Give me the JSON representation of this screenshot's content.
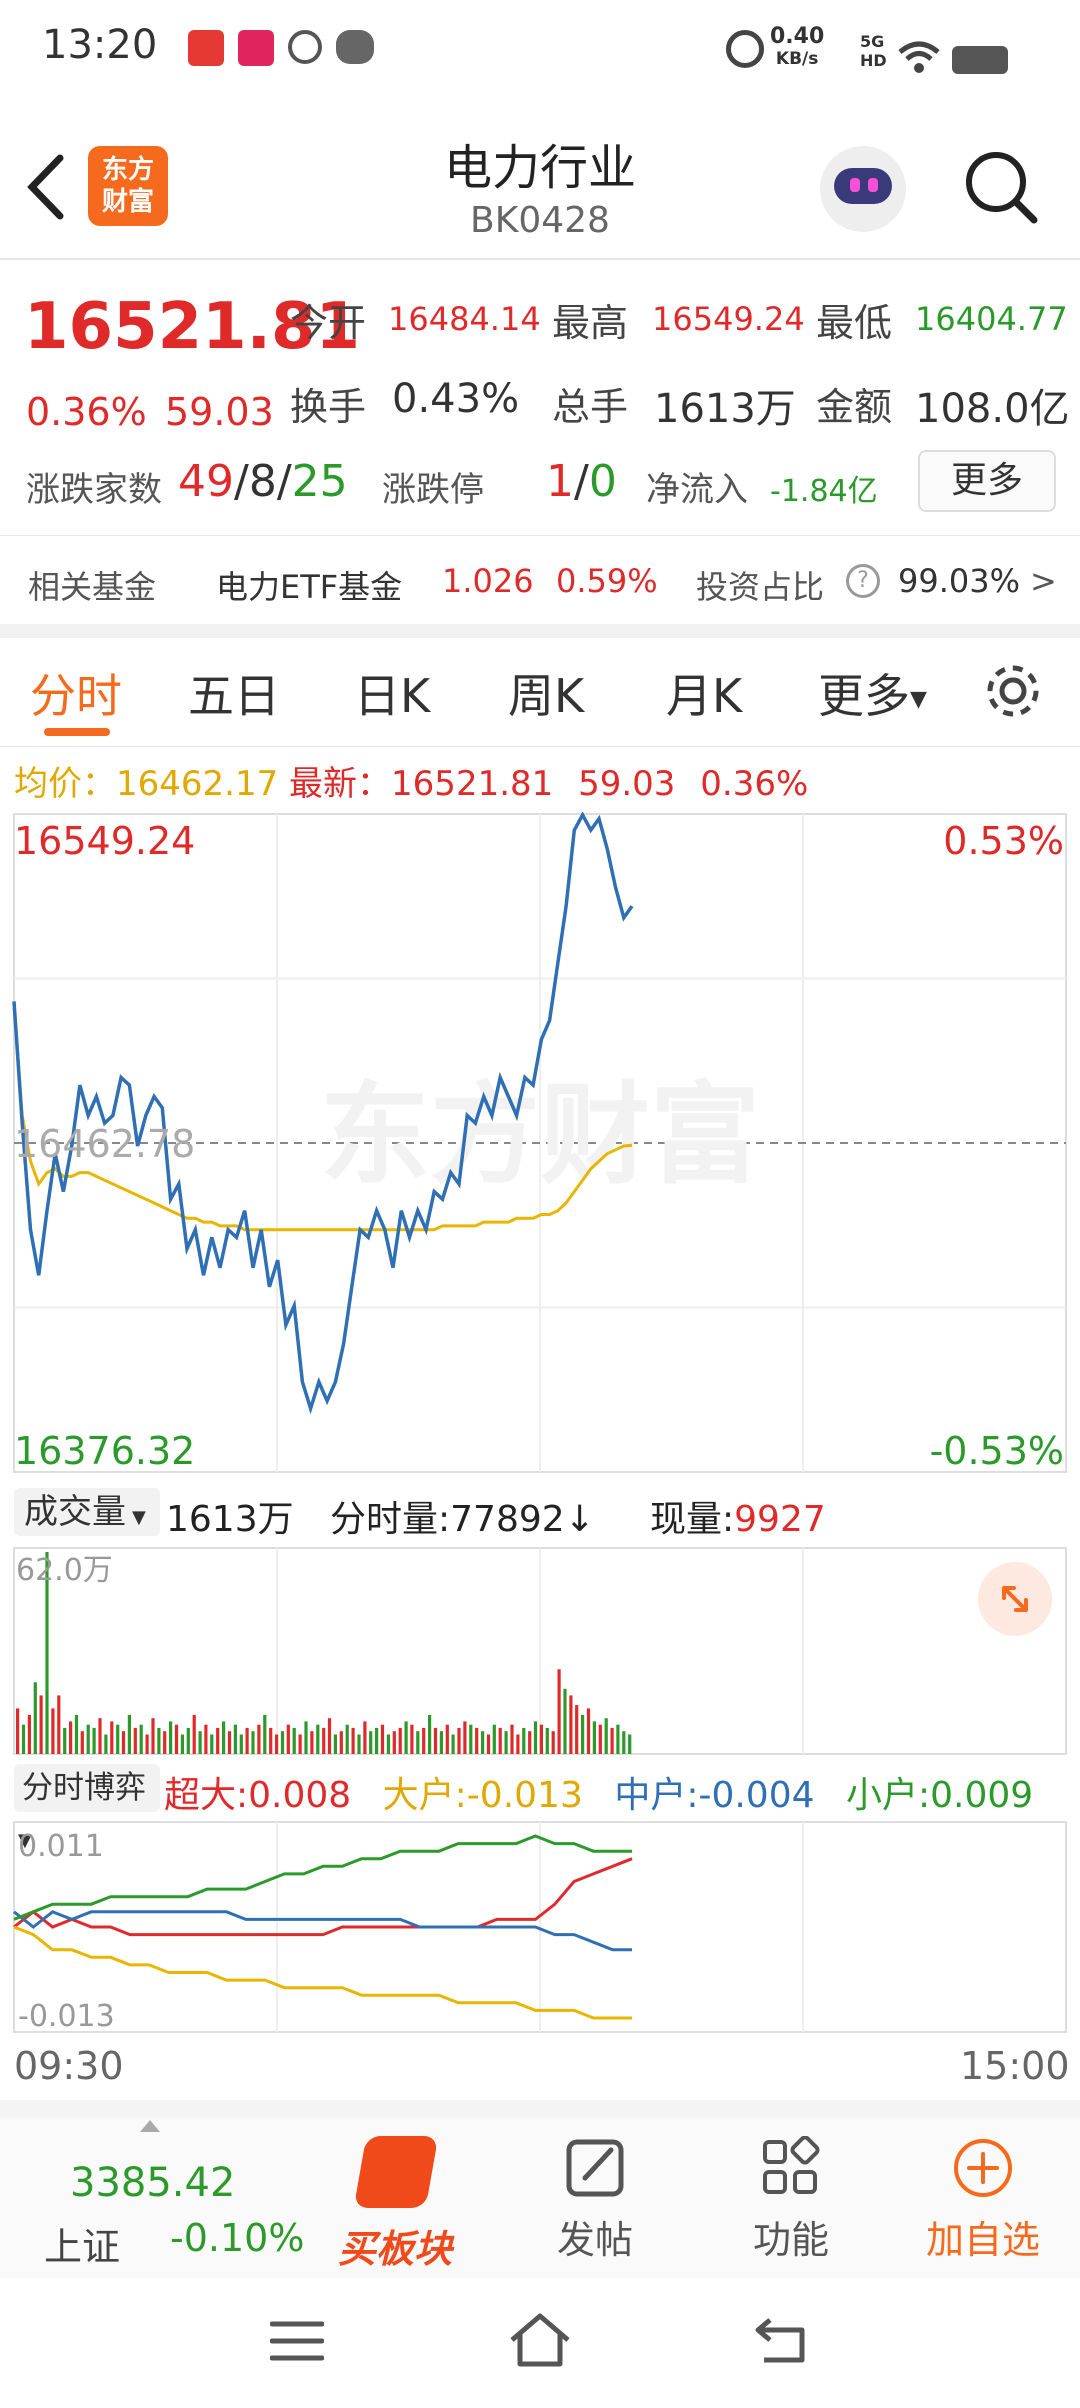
{
  "status_bar": {
    "time": "13:20",
    "net_speed": "0.40",
    "net_unit": "KB/s",
    "signal": "5G HD"
  },
  "header": {
    "title": "电力行业",
    "code": "BK0428",
    "logo_text_1": "东方",
    "logo_text_2": "财富"
  },
  "quote": {
    "price": "16521.81",
    "change_pct": "0.36%",
    "change": "59.03",
    "open_label": "今开",
    "open": "16484.14",
    "high_label": "最高",
    "high": "16549.24",
    "low_label": "最低",
    "low": "16404.77",
    "turnover_label": "换手",
    "turnover": "0.43%",
    "volume_label": "总手",
    "volume": "1613万",
    "amount_label": "金额",
    "amount": "108.0亿",
    "breadth_label": "涨跌家数",
    "up": "49",
    "flat": "8",
    "down": "25",
    "limit_label": "涨跌停",
    "limit_up": "1",
    "limit_down": "0",
    "inflow_label": "净流入",
    "inflow": "-1.84亿",
    "more_button": "更多"
  },
  "fund": {
    "label": "相关基金",
    "name": "电力ETF基金",
    "price": "1.026",
    "pct": "0.59%",
    "ratio_label": "投资占比",
    "ratio": "99.03%",
    "arrow": ">"
  },
  "tabs": [
    "分时",
    "五日",
    "日K",
    "周K",
    "月K",
    "更多"
  ],
  "info_line": {
    "avg_label": "均价：",
    "avg": "16462.17",
    "latest_label": "最新：",
    "latest": "16521.81",
    "chg": "59.03",
    "pct": "0.36%"
  },
  "chart_data": [
    {
      "type": "line",
      "name": "intraday",
      "ylim": [
        16376.32,
        16549.24
      ],
      "prev_close": 16462.78,
      "labels": {
        "top": "16549.24",
        "bottom": "16376.32",
        "mid": "16462.78",
        "top_pct": "0.53%",
        "bottom_pct": "-0.53%"
      },
      "watermark": "东方财富",
      "series": [
        {
          "values": [
            16500,
            16468,
            16440,
            16428,
            16445,
            16460,
            16450,
            16462,
            16478,
            16470,
            16475,
            16468,
            16470,
            16480,
            16478,
            16462,
            16470,
            16475,
            16472,
            16448,
            16452,
            16435,
            16440,
            16428,
            16438,
            16430,
            16440,
            16438,
            16445,
            16430,
            16440,
            16425,
            16432,
            16415,
            16420,
            16400,
            16393,
            16400,
            16395,
            16400,
            16410,
            16425,
            16440,
            16438,
            16445,
            16440,
            16430,
            16445,
            16438,
            16445,
            16440,
            16450,
            16448,
            16455,
            16452,
            16470,
            16468,
            16475,
            16470,
            16480,
            16475,
            16470,
            16480,
            16478,
            16490,
            16495,
            16510,
            16525,
            16545,
            16549,
            16545,
            16548,
            16540,
            16530,
            16522,
            16525
          ]
        },
        {
          "values": [
            16500,
            16470,
            16458,
            16452,
            16455,
            16456,
            16454,
            16454,
            16455,
            16455,
            16454,
            16453,
            16452,
            16451,
            16450,
            16449,
            16448,
            16447,
            16446,
            16445,
            16444,
            16443,
            16443,
            16442,
            16442,
            16441,
            16441,
            16441,
            16440,
            16440,
            16440,
            16440,
            16440,
            16440,
            16440,
            16440,
            16440,
            16440,
            16440,
            16440,
            16440,
            16440,
            16440,
            16440,
            16440,
            16440,
            16440,
            16440,
            16440,
            16440,
            16440,
            16440,
            16441,
            16441,
            16441,
            16441,
            16441,
            16442,
            16442,
            16442,
            16442,
            16443,
            16443,
            16443,
            16444,
            16444,
            16445,
            16447,
            16450,
            16453,
            16456,
            16458,
            16460,
            16461,
            16462,
            16462.17
          ]
        }
      ]
    },
    {
      "type": "bar",
      "name": "volume",
      "ylim": [
        0,
        62.0
      ],
      "max_label": "62.0万",
      "values": [
        14,
        9,
        12,
        22,
        18,
        62,
        14,
        18,
        8,
        10,
        12,
        7,
        9,
        8,
        11,
        6,
        10,
        9,
        7,
        12,
        8,
        9,
        6,
        11,
        8,
        7,
        10,
        9,
        6,
        8,
        12,
        7,
        9,
        6,
        8,
        10,
        7,
        9,
        6,
        8,
        7,
        9,
        12,
        8,
        6,
        7,
        9,
        8,
        6,
        10,
        7,
        9,
        8,
        11,
        6,
        7,
        9,
        8,
        6,
        10,
        7,
        8,
        9,
        6,
        7,
        8,
        10,
        9,
        7,
        8,
        12,
        8,
        7,
        9,
        6,
        8,
        10,
        9,
        8,
        7,
        6,
        9,
        8,
        7,
        9,
        6,
        8,
        7,
        10,
        9,
        8,
        7,
        26,
        20,
        18,
        15,
        12,
        14,
        10,
        9,
        11,
        8,
        9,
        7,
        6
      ],
      "colors": [
        "r",
        "g",
        "r",
        "g",
        "r",
        "g",
        "r",
        "r",
        "g",
        "r",
        "g",
        "r",
        "g",
        "g",
        "r",
        "g",
        "r",
        "g",
        "r",
        "g",
        "r",
        "g",
        "r",
        "r",
        "g",
        "r",
        "g",
        "r",
        "g",
        "g",
        "r",
        "g",
        "r",
        "g",
        "r",
        "g",
        "r",
        "g",
        "g",
        "r",
        "g",
        "r",
        "g",
        "r",
        "r",
        "g",
        "r",
        "g",
        "r",
        "g",
        "r",
        "g",
        "r",
        "r",
        "g",
        "r",
        "g",
        "r",
        "g",
        "r",
        "g",
        "g",
        "r",
        "g",
        "r",
        "r",
        "g",
        "r",
        "g",
        "r",
        "g",
        "r",
        "g",
        "r",
        "g",
        "r",
        "r",
        "g",
        "r",
        "g",
        "r",
        "g",
        "r",
        "g",
        "r",
        "r",
        "g",
        "r",
        "g",
        "r",
        "g",
        "r",
        "r",
        "g",
        "r",
        "r",
        "g",
        "r",
        "g",
        "r",
        "g",
        "r",
        "g",
        "g"
      ]
    },
    {
      "type": "line",
      "name": "fund_flow",
      "ylim": [
        -0.013,
        0.011
      ],
      "labels": {
        "top": "0.011",
        "bottom": "-0.013"
      },
      "series": [
        {
          "name": "超大",
          "values": [
            -0.001,
            0.001,
            -0.001,
            0.0,
            -0.001,
            -0.001,
            -0.002,
            -0.002,
            -0.002,
            -0.002,
            -0.002,
            -0.002,
            -0.002,
            -0.002,
            -0.002,
            -0.002,
            -0.002,
            -0.001,
            -0.001,
            -0.001,
            -0.001,
            -0.001,
            -0.001,
            -0.001,
            -0.001,
            0.0,
            0.0,
            0.0,
            0.002,
            0.005,
            0.006,
            0.007,
            0.008
          ]
        },
        {
          "name": "大户",
          "values": [
            -0.001,
            -0.002,
            -0.004,
            -0.004,
            -0.005,
            -0.005,
            -0.006,
            -0.006,
            -0.007,
            -0.007,
            -0.007,
            -0.008,
            -0.008,
            -0.008,
            -0.009,
            -0.009,
            -0.009,
            -0.009,
            -0.01,
            -0.01,
            -0.01,
            -0.01,
            -0.01,
            -0.011,
            -0.011,
            -0.011,
            -0.011,
            -0.012,
            -0.012,
            -0.012,
            -0.013,
            -0.013,
            -0.013
          ]
        },
        {
          "name": "中户",
          "values": [
            0.001,
            -0.001,
            0.001,
            0.0,
            0.001,
            0.001,
            0.001,
            0.001,
            0.001,
            0.001,
            0.001,
            0.001,
            0.0,
            0.0,
            0.0,
            0.0,
            0.0,
            0.0,
            0.0,
            0.0,
            0.0,
            -0.001,
            -0.001,
            -0.001,
            -0.001,
            -0.001,
            -0.001,
            -0.001,
            -0.002,
            -0.002,
            -0.003,
            -0.004,
            -0.004
          ]
        },
        {
          "name": "小户",
          "values": [
            0.0,
            0.001,
            0.002,
            0.002,
            0.002,
            0.003,
            0.003,
            0.003,
            0.003,
            0.003,
            0.004,
            0.004,
            0.004,
            0.005,
            0.006,
            0.006,
            0.007,
            0.007,
            0.008,
            0.008,
            0.009,
            0.009,
            0.009,
            0.01,
            0.01,
            0.01,
            0.01,
            0.011,
            0.01,
            0.01,
            0.009,
            0.009,
            0.009
          ]
        }
      ]
    }
  ],
  "volume_bar": {
    "selector": "成交量",
    "total": "1613万",
    "tick_label": "分时量:",
    "tick": "77892",
    "tick_arrow": "↓",
    "now_label": "现量:",
    "now": "9927"
  },
  "flow_bar": {
    "selector": "分时博弈",
    "s_label": "超大:",
    "s_val": "0.008",
    "l_label": "大户:",
    "l_val": "-0.013",
    "m_label": "中户:",
    "m_val": "-0.004",
    "x_label": "小户:",
    "x_val": "0.009"
  },
  "time_axis": {
    "start": "09:30",
    "end": "15:00"
  },
  "bottom_nav": {
    "index_value": "3385.42",
    "index_name": "上证",
    "index_pct": "-0.10%",
    "buy": "买板块",
    "post": "发帖",
    "func": "功能",
    "add": "加自选"
  },
  "colors": {
    "red": "#e02a2a",
    "green": "#2b9a2b",
    "blue": "#2f6fb4",
    "yellow": "#e8b500",
    "accent": "#f56a1d"
  }
}
